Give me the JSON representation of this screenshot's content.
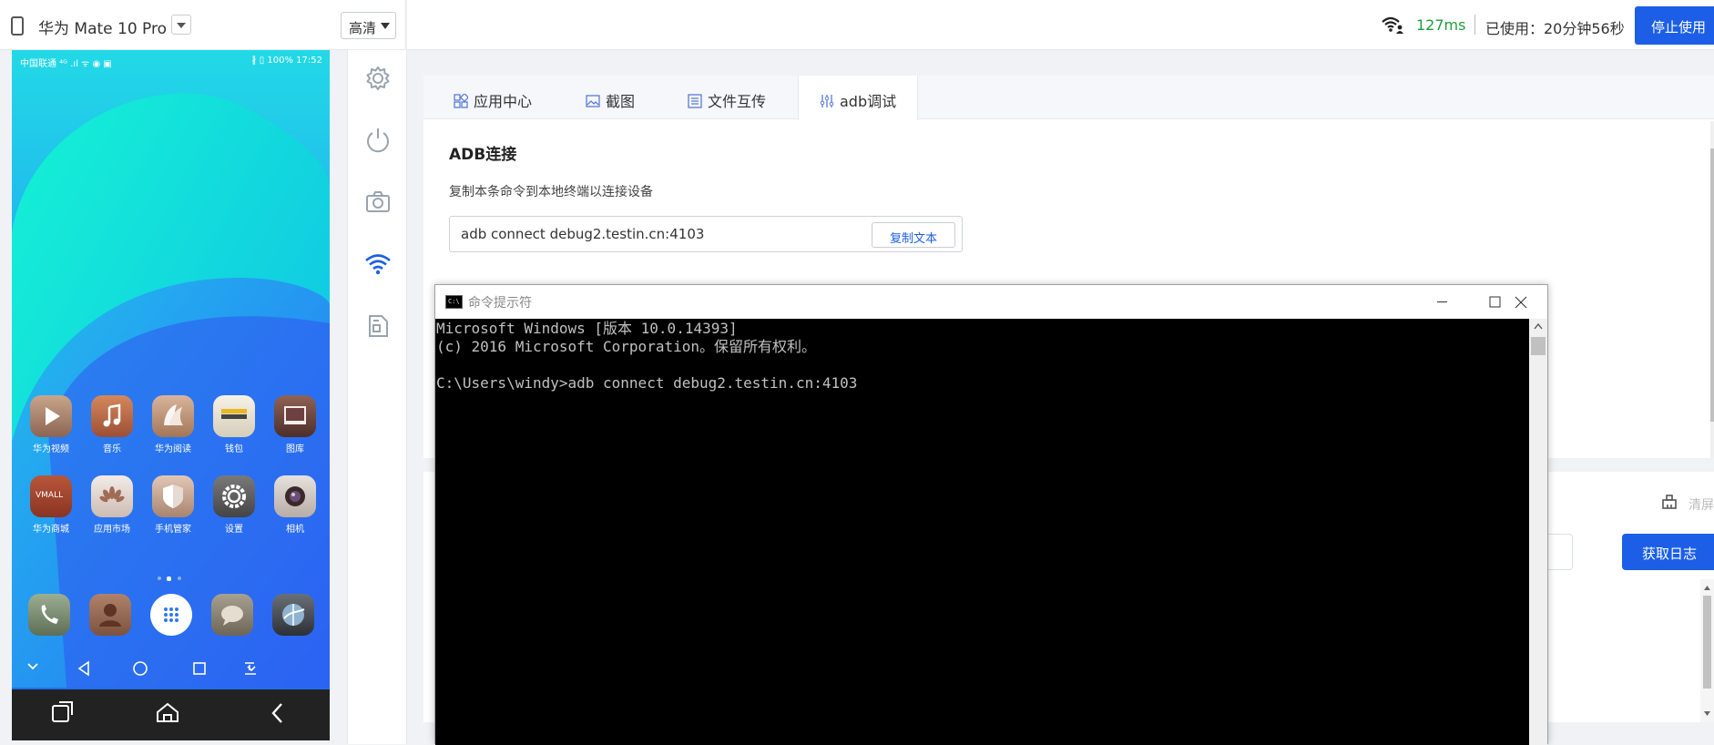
{
  "device_header": {
    "device_name": "华为 Mate 10 Pro",
    "quality": "高清"
  },
  "top_header": {
    "latency": "127ms",
    "usage": "已使用：20分钟56秒",
    "stop_button": "停止使用"
  },
  "phone": {
    "status_left": "中国联通 ⁴ᴳ .ıl ᯤ ◉ ▣",
    "status_right": "∦ ▯ 100%  17:52",
    "apps_row1": [
      "华为视频",
      "音乐",
      "华为阅读",
      "钱包",
      "图库"
    ],
    "apps_row2": [
      "华为商城",
      "应用市场",
      "手机管家",
      "设置",
      "相机"
    ],
    "vmall_text": "VMALL"
  },
  "tabs": [
    "应用中心",
    "截图",
    "文件互传",
    "adb调试"
  ],
  "active_tab": "adb调试",
  "adb": {
    "title": "ADB连接",
    "description": "复制本条命令到本地终端以连接设备",
    "command": "adb connect debug2.testin.cn:4103",
    "copy_button": "复制文本"
  },
  "lower": {
    "get_log_button": "获取日志",
    "clear_label": "清屏"
  },
  "cmd": {
    "title": "命令提示符",
    "icon_text": "C:\\",
    "lines": [
      "Microsoft Windows [版本 10.0.14393]",
      "(c) 2016 Microsoft Corporation。保留所有权利。",
      "",
      "C:\\Users\\windy>adb connect debug2.testin.cn:4103"
    ]
  },
  "colors": {
    "brand_blue": "#1c5fe6",
    "latency_green": "#1f9d3e"
  }
}
